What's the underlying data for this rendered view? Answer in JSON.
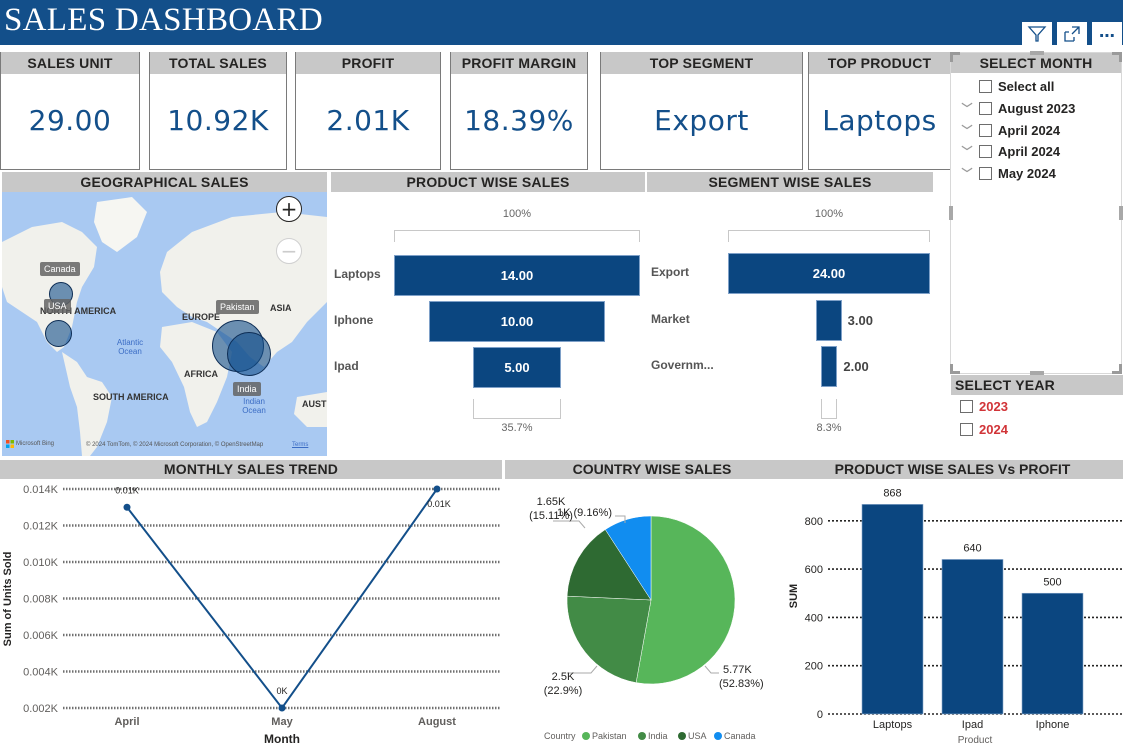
{
  "header": {
    "title": "SALES DASHBOARD",
    "buttons": [
      {
        "name": "filter-icon",
        "glyph": "filter"
      },
      {
        "name": "focus-mode-icon",
        "glyph": "expand"
      },
      {
        "name": "more-options-icon",
        "glyph": "⋯"
      }
    ]
  },
  "kpis": [
    {
      "label": "SALES UNIT",
      "value": "29.00"
    },
    {
      "label": "TOTAL SALES",
      "value": "10.92K"
    },
    {
      "label": "PROFIT",
      "value": "2.01K"
    },
    {
      "label": "PROFIT MARGIN",
      "value": "18.39%"
    },
    {
      "label": "TOP SEGMENT",
      "value": "Export"
    },
    {
      "label": "TOP PRODUCT",
      "value": "Laptops"
    }
  ],
  "month_slicer": {
    "title": "SELECT MONTH",
    "select_all": "Select all",
    "items": [
      "August 2023",
      "April 2024",
      "April 2024",
      "May 2024"
    ]
  },
  "year_slicer": {
    "title": "SELECT YEAR",
    "items": [
      "2023",
      "2024"
    ],
    "item_color": "#d13438"
  },
  "geo": {
    "title": "GEOGRAPHICAL SALES",
    "continents": [
      "NORTH AMERICA",
      "EUROPE",
      "ASIA",
      "AFRICA",
      "SOUTH AMERICA",
      "AUSTI"
    ],
    "oceans": [
      "Atlantic Ocean",
      "Indian Ocean"
    ],
    "countries": [
      "Canada",
      "USA",
      "Pakistan",
      "India"
    ],
    "bing": "Microsoft Bing",
    "copyright": "© 2024 TomTom, © 2024 Microsoft Corporation, © OpenStreetMap",
    "terms": "Terms",
    "zoom_in": "+",
    "zoom_out": "−"
  },
  "product_funnel": {
    "title": "PRODUCT WISE SALES",
    "top_pct": "100%",
    "bottom_pct": "35.7%",
    "items": [
      {
        "label": "Laptops",
        "value": 14,
        "display": "14.00"
      },
      {
        "label": "Iphone",
        "value": 10,
        "display": "10.00"
      },
      {
        "label": "Ipad",
        "value": 5,
        "display": "5.00"
      }
    ]
  },
  "segment_funnel": {
    "title": "SEGMENT WISE SALES",
    "top_pct": "100%",
    "bottom_pct": "8.3%",
    "items": [
      {
        "label": "Export",
        "value": 24,
        "display": "24.00"
      },
      {
        "label": "Market",
        "value": 3,
        "display": "3.00"
      },
      {
        "label": "Governm...",
        "value": 2,
        "display": "2.00"
      }
    ]
  },
  "chart_data": [
    {
      "id": "monthly",
      "type": "line",
      "title": "MONTHLY SALES TREND",
      "xlabel": "Month",
      "ylabel": "Sum of Units Sold",
      "categories": [
        "April",
        "May",
        "August"
      ],
      "values": [
        0.013,
        0.002,
        0.014
      ],
      "data_labels": [
        "0.01K",
        "0K",
        "0.01K"
      ],
      "yticks": [
        "0.002K",
        "0.004K",
        "0.006K",
        "0.008K",
        "0.010K",
        "0.012K",
        "0.014K"
      ],
      "ylim": [
        0.002,
        0.014
      ],
      "grid": true,
      "color": "#134f8a"
    },
    {
      "id": "country",
      "type": "pie",
      "title": "COUNTRY WISE SALES",
      "legend_title": "Country",
      "legend_position": "bottom",
      "slices": [
        {
          "name": "Pakistan",
          "value": 5.77,
          "label": "5.77K",
          "pct": "(52.83%)",
          "color": "#57b65a"
        },
        {
          "name": "India",
          "value": 2.5,
          "label": "2.5K",
          "pct": "(22.9%)",
          "color": "#428b46"
        },
        {
          "name": "USA",
          "value": 1.65,
          "label": "1.65K",
          "pct": "(15.11%)",
          "color": "#2e6a32"
        },
        {
          "name": "Canada",
          "value": 1.0,
          "label": "1K",
          "pct": "(9.16%)",
          "color": "#118df0"
        }
      ]
    },
    {
      "id": "profit",
      "type": "bar",
      "title": "PRODUCT WISE SALES Vs PROFIT",
      "xlabel": "Product",
      "ylabel": "SUM",
      "categories": [
        "Laptops",
        "Ipad",
        "Iphone"
      ],
      "values": [
        868,
        640,
        500
      ],
      "yticks": [
        "0",
        "200",
        "400",
        "600",
        "800"
      ],
      "ylim": [
        0,
        900
      ],
      "grid": true,
      "color": "#0b4680"
    }
  ]
}
